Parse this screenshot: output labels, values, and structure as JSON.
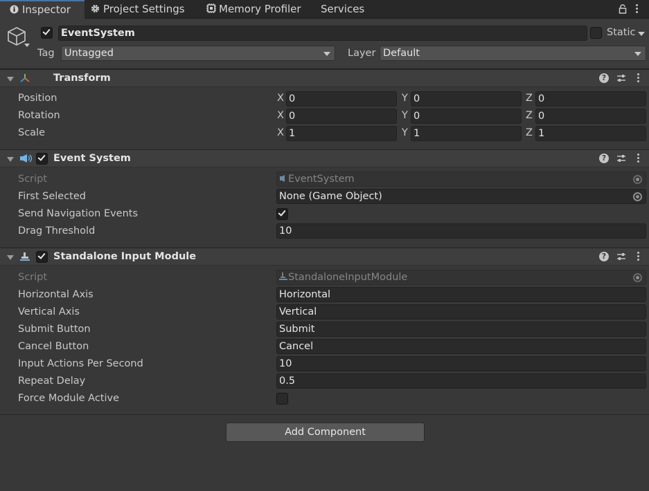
{
  "tabs": [
    {
      "label": "Inspector",
      "icon": "info-icon",
      "active": true
    },
    {
      "label": "Project Settings",
      "icon": "gear-icon"
    },
    {
      "label": "Memory Profiler",
      "icon": "chip-icon"
    },
    {
      "label": "Services"
    }
  ],
  "header": {
    "object_name": "EventSystem",
    "active": true,
    "static_label": "Static",
    "static_checked": false,
    "tag_label": "Tag",
    "tag_value": "Untagged",
    "layer_label": "Layer",
    "layer_value": "Default"
  },
  "transform": {
    "title": "Transform",
    "rows": [
      {
        "label": "Position",
        "x": "0",
        "y": "0",
        "z": "0"
      },
      {
        "label": "Rotation",
        "x": "0",
        "y": "0",
        "z": "0"
      },
      {
        "label": "Scale",
        "x": "1",
        "y": "1",
        "z": "1"
      }
    ],
    "axis_x": "X",
    "axis_y": "Y",
    "axis_z": "Z"
  },
  "event_system": {
    "title": "Event System",
    "enabled": true,
    "script_label": "Script",
    "script_value": "EventSystem",
    "first_selected_label": "First Selected",
    "first_selected_value": "None (Game Object)",
    "send_nav_label": "Send Navigation Events",
    "send_nav_checked": true,
    "drag_threshold_label": "Drag Threshold",
    "drag_threshold_value": "10"
  },
  "standalone": {
    "title": "Standalone Input Module",
    "enabled": true,
    "script_label": "Script",
    "script_value": "StandaloneInputModule",
    "horizontal_label": "Horizontal Axis",
    "horizontal_value": "Horizontal",
    "vertical_label": "Vertical Axis",
    "vertical_value": "Vertical",
    "submit_label": "Submit Button",
    "submit_value": "Submit",
    "cancel_label": "Cancel Button",
    "cancel_value": "Cancel",
    "ips_label": "Input Actions Per Second",
    "ips_value": "10",
    "repeat_label": "Repeat Delay",
    "repeat_value": "0.5",
    "force_label": "Force Module Active",
    "force_checked": false
  },
  "add_component_label": "Add Component",
  "colors": {
    "accent": "#3a79bb",
    "panel": "#383838",
    "field": "#2a2a2a"
  }
}
